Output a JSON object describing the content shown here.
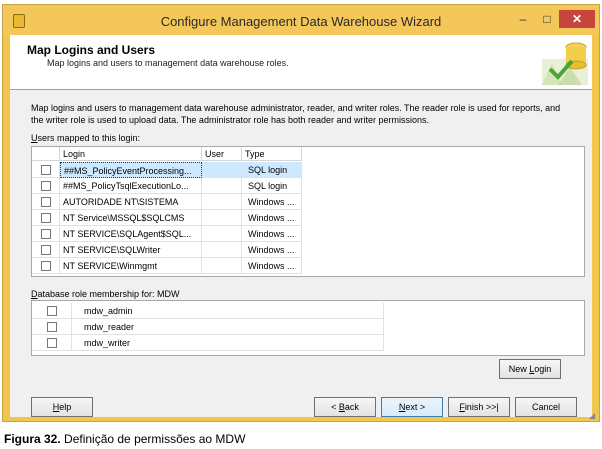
{
  "window": {
    "title": "Configure Management Data Warehouse Wizard",
    "controls": {
      "minimize": "–",
      "maximize": "□",
      "close": "✕"
    }
  },
  "header": {
    "title": "Map Logins and Users",
    "subtitle": "Map logins and users to management data warehouse roles."
  },
  "description": "Map logins and users to management data warehouse administrator, reader, and writer roles. The reader role is used for reports, and the writer role is used to upload data. The administrator role has both reader and writer permissions.",
  "users_section": {
    "label_hotkey": "U",
    "label_rest": "sers mapped to this login:",
    "columns": [
      "Login",
      "User",
      "Type"
    ],
    "rows": [
      {
        "login": "##MS_PolicyEventProcessing...",
        "user": "",
        "type": "SQL login",
        "checked": false,
        "selected": true
      },
      {
        "login": "##MS_PolicyTsqlExecutionLo...",
        "user": "",
        "type": "SQL login",
        "checked": false,
        "selected": false
      },
      {
        "login": "AUTORIDADE NT\\SISTEMA",
        "user": "",
        "type": "Windows ...",
        "checked": false,
        "selected": false
      },
      {
        "login": "NT Service\\MSSQL$SQLCMS",
        "user": "",
        "type": "Windows ...",
        "checked": false,
        "selected": false
      },
      {
        "login": "NT SERVICE\\SQLAgent$SQL...",
        "user": "",
        "type": "Windows ...",
        "checked": false,
        "selected": false
      },
      {
        "login": "NT SERVICE\\SQLWriter",
        "user": "",
        "type": "Windows ...",
        "checked": false,
        "selected": false
      },
      {
        "login": "NT SERVICE\\Winmgmt",
        "user": "",
        "type": "Windows ...",
        "checked": false,
        "selected": false
      }
    ]
  },
  "roles_section": {
    "label_hotkey": "D",
    "label_rest": "atabase role membership for: MDW",
    "roles": [
      {
        "name": "mdw_admin",
        "checked": false
      },
      {
        "name": "mdw_reader",
        "checked": false
      },
      {
        "name": "mdw_writer",
        "checked": false
      }
    ]
  },
  "buttons": {
    "new_login": {
      "pre": "New ",
      "hotkey": "L",
      "post": "ogin"
    },
    "help": {
      "pre": "",
      "hotkey": "H",
      "post": "elp"
    },
    "back": {
      "pre": "< ",
      "hotkey": "B",
      "post": "ack"
    },
    "next": {
      "pre": "",
      "hotkey": "N",
      "post": "ext >"
    },
    "finish": {
      "pre": "",
      "hotkey": "F",
      "post": "inish >>|"
    },
    "cancel": {
      "pre": "Cancel",
      "hotkey": "",
      "post": ""
    }
  },
  "caption": {
    "bold": "Figura 32.",
    "text": " Definição de permissões ao MDW"
  },
  "colors": {
    "titlebar": "#f3c75a",
    "close_button": "#c7463c",
    "selection": "#cde8ff"
  }
}
